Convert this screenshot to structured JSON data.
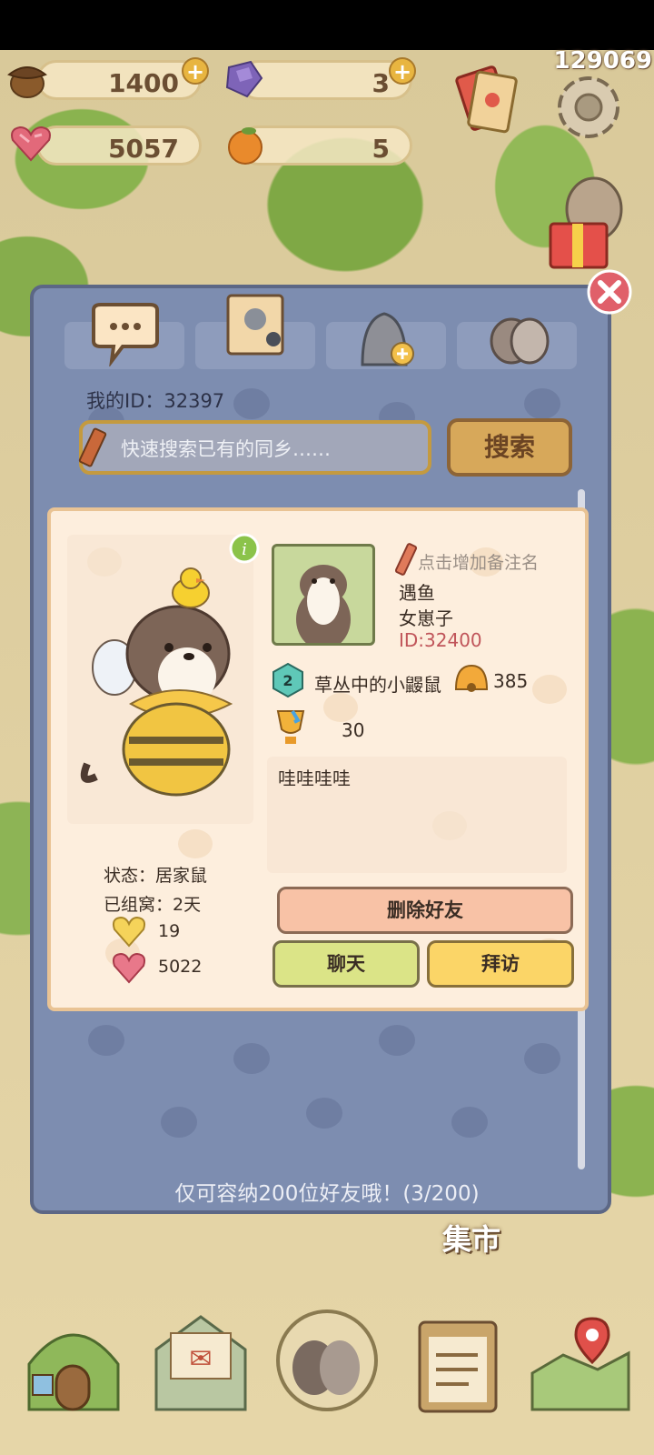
{
  "status_bar": {},
  "resources": {
    "acorns": "1400",
    "gems": "3",
    "love": "5057",
    "oranges": "5",
    "acorn_icon": "acorn-icon",
    "gem_icon": "gem-icon",
    "love_icon": "heart-gem-icon",
    "orange_icon": "orange-icon"
  },
  "top_right": {
    "counter": "129069"
  },
  "dialog": {
    "tabs": [
      {
        "icon": "chat-bubble-icon"
      },
      {
        "icon": "friend-book-icon"
      },
      {
        "icon": "add-friend-icon"
      },
      {
        "icon": "paw-icon"
      }
    ],
    "my_id": "我的ID：32397",
    "search_placeholder": "快速搜索已有的同乡……",
    "search_button": "搜索",
    "capacity_note": "仅可容纳200位好友哦！(3/200)"
  },
  "friend_card": {
    "note_prompt": "点击增加备注名",
    "nickname": "遇鱼",
    "gender": "女崽子",
    "id": "ID:32400",
    "level": "2",
    "title": "草丛中的小鼹鼠",
    "bells": "385",
    "trophies": "30",
    "bio": "哇哇哇哇",
    "status": "状态：居家鼠",
    "nest_days": "已组窝：2天",
    "hearts": "19",
    "love": "5022",
    "delete_button": "删除好友",
    "chat_button": "聊天",
    "visit_button": "拜访"
  },
  "map": {
    "market_label": "集市"
  },
  "colors": {
    "dialog_bg": "#7d8db0",
    "card_bg": "#fdeedd",
    "delete_btn": "#f8c2a6",
    "chat_btn": "#dbe487",
    "visit_btn": "#fbd567",
    "search_btn": "#d7a85a"
  }
}
